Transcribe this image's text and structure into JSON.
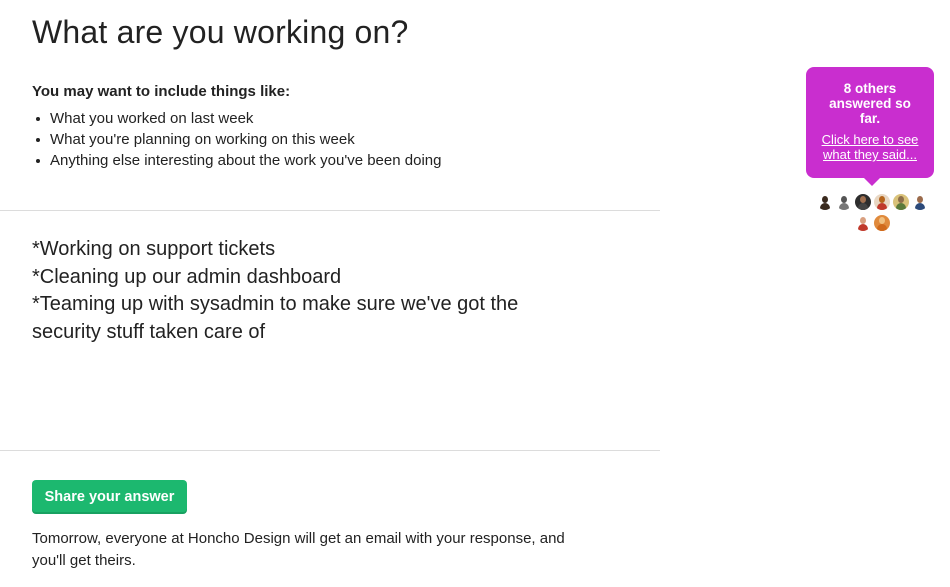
{
  "question": {
    "title": "What are you working on?",
    "hint_heading": "You may want to include things like:",
    "hints": [
      "What you worked on last week",
      "What you're planning on working on this week",
      "Anything else interesting about the work you've been doing"
    ]
  },
  "answer": {
    "lines": [
      "*Working on support tickets",
      "*Cleaning up our admin dashboard",
      "*Teaming up with sysadmin to make sure we've got the",
      "security stuff taken care of"
    ]
  },
  "actions": {
    "share_label": "Share your answer",
    "footer_note": "Tomorrow, everyone at Honcho Design will get an email with your response, and you'll get theirs."
  },
  "sidebar": {
    "others_count_text": "8 others answered so far.",
    "others_link_text": "Click here to see what they said...",
    "bubble_color": "#c92ecf",
    "avatars": [
      {
        "name": "avatar-1",
        "bg": "#ffffff",
        "head": "#3a2a1e",
        "body": "#3a2a1e"
      },
      {
        "name": "avatar-2",
        "bg": "#ffffff",
        "head": "#555555",
        "body": "#777777"
      },
      {
        "name": "avatar-3",
        "bg": "#2d2d2d",
        "head": "#a07050",
        "body": "#444444"
      },
      {
        "name": "avatar-4",
        "bg": "#e8d7c3",
        "head": "#b5651d",
        "body": "#c0392b"
      },
      {
        "name": "avatar-5",
        "bg": "#d9c27a",
        "head": "#8d6e4a",
        "body": "#5a7a3a"
      },
      {
        "name": "avatar-6",
        "bg": "#ffffff",
        "head": "#9b6b4c",
        "body": "#2c4a7a"
      },
      {
        "name": "avatar-7",
        "bg": "#ffffff",
        "head": "#d9a080",
        "body": "#c0392b"
      },
      {
        "name": "avatar-8",
        "bg": "#e08a3c",
        "head": "#f0c080",
        "body": "#d06a1c"
      }
    ]
  },
  "colors": {
    "accent_green": "#1cb86f",
    "text": "#222222",
    "divider": "#dcdcdc"
  }
}
